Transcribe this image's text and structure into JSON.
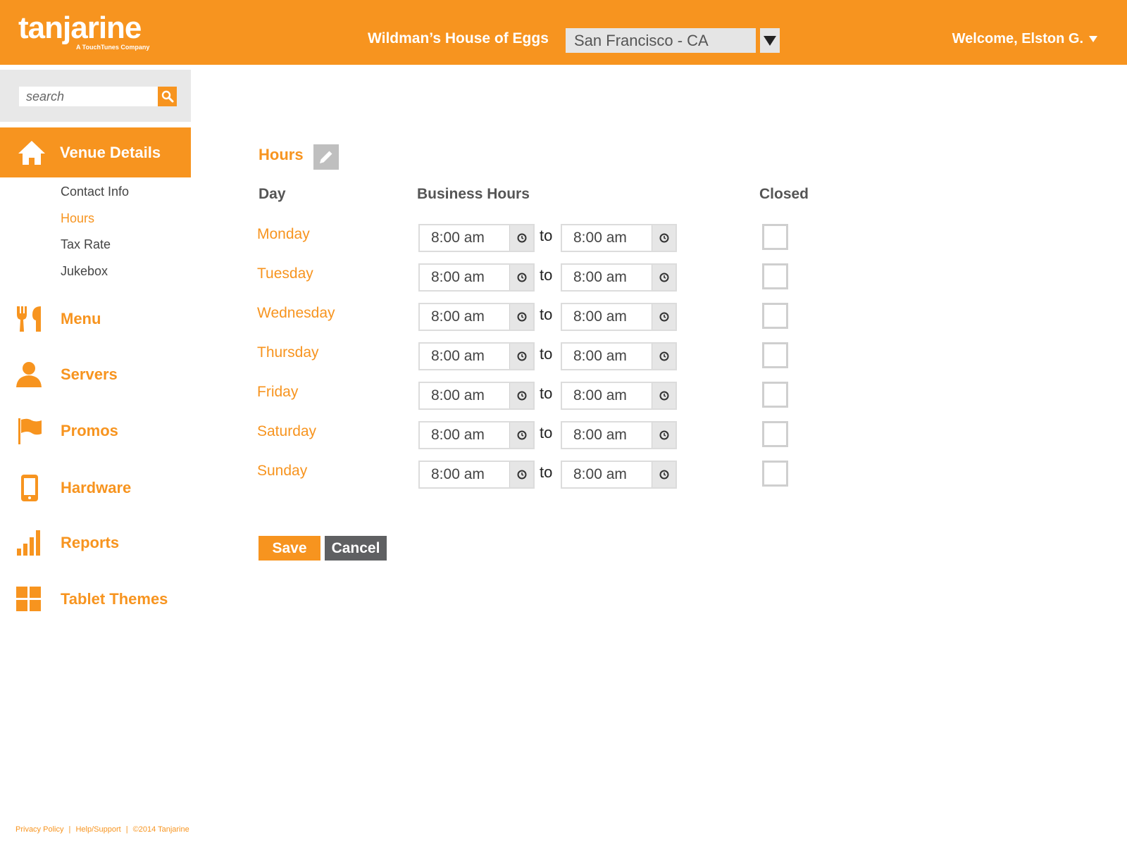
{
  "brand": {
    "logo_text": "tanjarine",
    "logo_tagline": "A TouchTunes Company",
    "accent_color": "#F7941F",
    "dark_button_color": "#5f6062"
  },
  "header": {
    "venue_name": "Wildman’s House of Eggs",
    "location_value": "San Francisco - CA",
    "welcome_text": "Welcome, Elston G."
  },
  "search": {
    "placeholder": "search",
    "icon": "search-icon"
  },
  "sidebar": {
    "active_item": {
      "label": "Venue Details",
      "icon": "home-icon"
    },
    "subitems": [
      {
        "label": "Contact Info",
        "active": false
      },
      {
        "label": "Hours",
        "active": true
      },
      {
        "label": "Tax Rate",
        "active": false
      },
      {
        "label": "Jukebox",
        "active": false
      }
    ],
    "items": [
      {
        "label": "Menu",
        "icon": "utensils-icon"
      },
      {
        "label": "Servers",
        "icon": "person-icon"
      },
      {
        "label": "Promos",
        "icon": "flag-icon"
      },
      {
        "label": "Hardware",
        "icon": "tablet-icon"
      },
      {
        "label": "Reports",
        "icon": "bar-chart-icon"
      },
      {
        "label": "Tablet Themes",
        "icon": "grid-icon"
      }
    ]
  },
  "main": {
    "section_title": "Hours",
    "columns": {
      "day": "Day",
      "business_hours": "Business Hours",
      "closed": "Closed"
    },
    "to_label": "to",
    "days": [
      {
        "day": "Monday",
        "open": "8:00 am",
        "close": "8:00 am",
        "closed": false
      },
      {
        "day": "Tuesday",
        "open": "8:00 am",
        "close": "8:00 am",
        "closed": false
      },
      {
        "day": "Wednesday",
        "open": "8:00 am",
        "close": "8:00 am",
        "closed": false
      },
      {
        "day": "Thursday",
        "open": "8:00 am",
        "close": "8:00 am",
        "closed": false
      },
      {
        "day": "Friday",
        "open": "8:00 am",
        "close": "8:00 am",
        "closed": false
      },
      {
        "day": "Saturday",
        "open": "8:00 am",
        "close": "8:00 am",
        "closed": false
      },
      {
        "day": "Sunday",
        "open": "8:00 am",
        "close": "8:00 am",
        "closed": false
      }
    ],
    "save_label": "Save",
    "cancel_label": "Cancel"
  },
  "footer": {
    "privacy": "Privacy Policy",
    "help": "Help/Support",
    "copyright": "©2014 Tanjarine"
  }
}
